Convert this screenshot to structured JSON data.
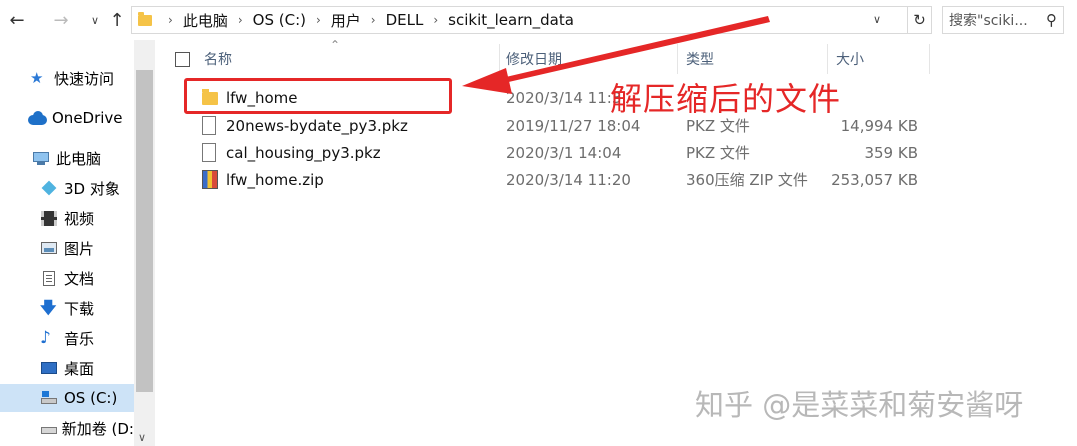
{
  "address_bar": {
    "breadcrumbs": [
      "此电脑",
      "OS (C:)",
      "用户",
      "DELL",
      "scikit_learn_data"
    ],
    "search_placeholder": "搜索\"sciki..."
  },
  "nav_pane": {
    "items": [
      {
        "label": "快速访问",
        "icon": "star-icon"
      },
      {
        "label": "OneDrive",
        "icon": "cloud-icon"
      },
      {
        "label": "此电脑",
        "icon": "computer-icon"
      },
      {
        "label": "3D 对象",
        "icon": "cube-icon"
      },
      {
        "label": "视频",
        "icon": "film-icon"
      },
      {
        "label": "图片",
        "icon": "picture-icon"
      },
      {
        "label": "文档",
        "icon": "document-icon"
      },
      {
        "label": "下载",
        "icon": "download-icon"
      },
      {
        "label": "音乐",
        "icon": "music-icon"
      },
      {
        "label": "桌面",
        "icon": "desktop-icon"
      },
      {
        "label": "OS (C:)",
        "icon": "windows-drive-icon",
        "selected": true
      },
      {
        "label": "新加卷 (D:",
        "icon": "drive-icon"
      }
    ]
  },
  "columns": {
    "name": "名称",
    "date": "修改日期",
    "type": "类型",
    "size": "大小"
  },
  "files": [
    {
      "name": "lfw_home",
      "date": "2020/3/14 11:3",
      "type": "",
      "size": "",
      "icon": "folder-icon"
    },
    {
      "name": "20news-bydate_py3.pkz",
      "date": "2019/11/27 18:04",
      "type": "PKZ 文件",
      "size": "14,994 KB",
      "icon": "file-icon"
    },
    {
      "name": "cal_housing_py3.pkz",
      "date": "2020/3/1 14:04",
      "type": "PKZ 文件",
      "size": "359 KB",
      "icon": "file-icon"
    },
    {
      "name": "lfw_home.zip",
      "date": "2020/3/14 11:20",
      "type": "360压缩 ZIP 文件",
      "size": "253,057 KB",
      "icon": "zip-icon"
    }
  ],
  "annotation": {
    "text": "解压缩后的文件",
    "color": "#e52727"
  },
  "watermark": "知乎 @是菜菜和菊安酱呀"
}
